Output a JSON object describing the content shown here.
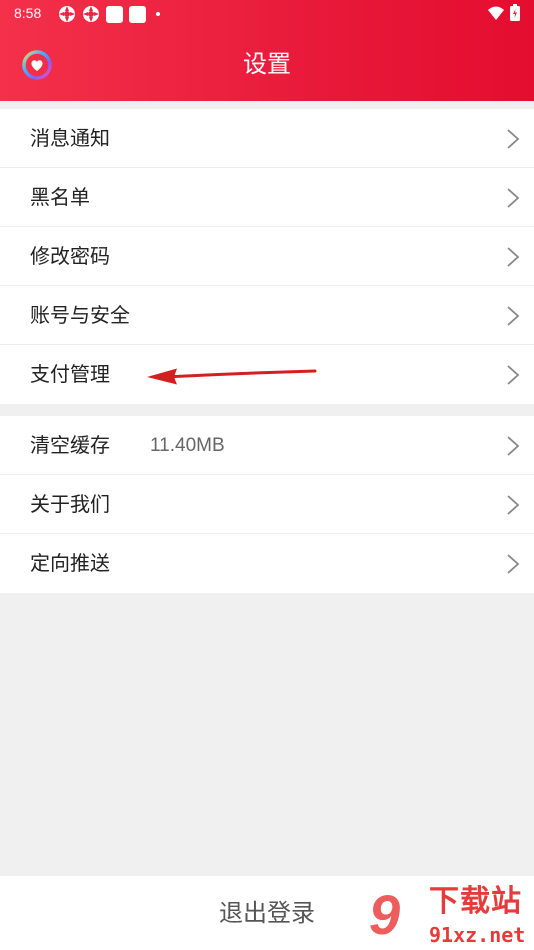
{
  "status_bar": {
    "time": "8:58",
    "icons": [
      "app-notification-icon",
      "app-notification-icon",
      "square-notification-icon",
      "square-notification-icon",
      "more-dot-icon"
    ],
    "right_icons": [
      "wifi-icon",
      "battery-icon"
    ]
  },
  "header": {
    "title": "设置",
    "logo_icon": "heart-logo-icon",
    "background": "#e8193a"
  },
  "group1": {
    "items": [
      {
        "label": "消息通知"
      },
      {
        "label": "黑名单"
      },
      {
        "label": "修改密码"
      },
      {
        "label": "账号与安全"
      },
      {
        "label": "支付管理"
      }
    ]
  },
  "group2": {
    "items": [
      {
        "label": "清空缓存",
        "value": "11.40MB"
      },
      {
        "label": "关于我们"
      },
      {
        "label": "定向推送"
      }
    ]
  },
  "annotation": {
    "type": "red-arrow",
    "points_to": "支付管理",
    "color": "#d21f1f"
  },
  "footer": {
    "logout_label": "退出登录"
  },
  "watermark": {
    "big": "9",
    "top": "下载站",
    "bottom": "91xz.net"
  }
}
